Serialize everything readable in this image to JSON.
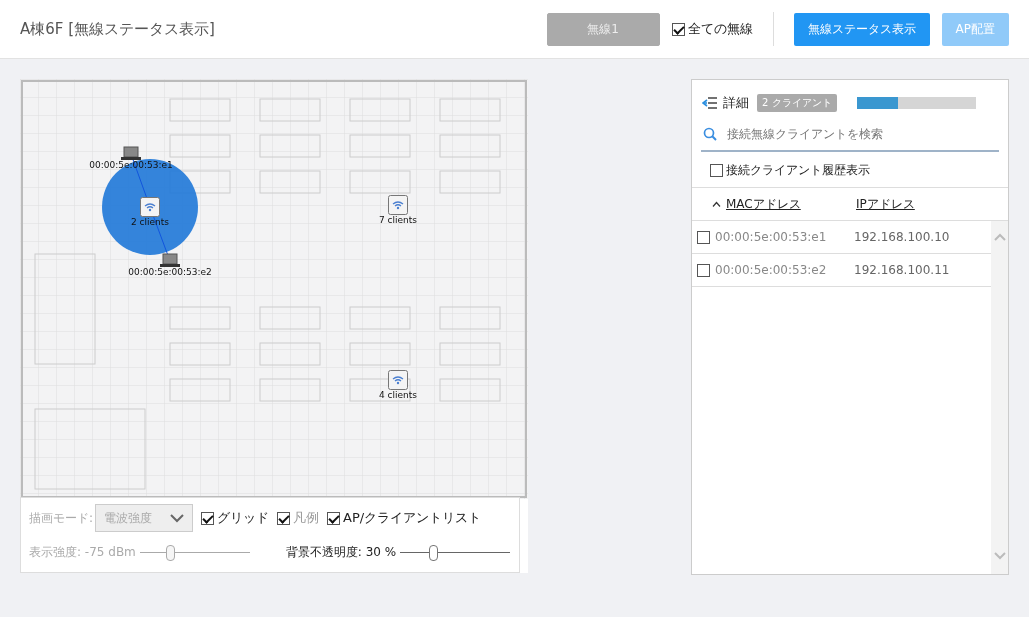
{
  "header": {
    "title": "A棟6F [無線ステータス表示]",
    "radio_select": {
      "label": "無線1",
      "disabled": true
    },
    "all_radios": {
      "label": "全ての無線",
      "checked": true
    },
    "buttons": [
      {
        "label": "無線ステータス表示",
        "disabled": false
      },
      {
        "label": "AP配置",
        "disabled": true
      }
    ]
  },
  "map": {
    "access_points": [
      {
        "label": "2 clients",
        "selected": true,
        "clients": [
          {
            "label": "00:00:5e:00:53:e1"
          },
          {
            "label": "00:00:5e:00:53:e2"
          }
        ]
      },
      {
        "label": "7 clients",
        "selected": false
      },
      {
        "label": "4 clients",
        "selected": false
      }
    ],
    "controls": {
      "mode_label": "描画モード:",
      "mode_select": {
        "value": "電波強度",
        "disabled": true
      },
      "checkboxes": [
        {
          "label": "グリッド",
          "checked": true,
          "disabled": false
        },
        {
          "label": "凡例",
          "checked": true,
          "disabled": true
        },
        {
          "label": "AP/クライアントリスト",
          "checked": true,
          "disabled": false
        }
      ],
      "sliders": [
        {
          "label": "表示強度: -75 dBm",
          "level": 0.27,
          "disabled": true
        },
        {
          "label": "背景不透明度: 30 %",
          "level": 0.3,
          "disabled": false
        }
      ]
    }
  },
  "details": {
    "title": "詳細",
    "badge": "2 クライアント",
    "level": 0.35,
    "search": {
      "placeholder": "接続無線クライアントを検索"
    },
    "history": {
      "label": "接続クライアント履歴表示",
      "checked": false
    },
    "columns": [
      {
        "label": "MACアドレス",
        "sorted": true
      },
      {
        "label": "IPアドレス",
        "sorted": false
      }
    ],
    "rows": [
      {
        "mac": "00:00:5e:00:53:e1",
        "ip": "192.168.100.10",
        "checked": false
      },
      {
        "mac": "00:00:5e:00:53:e2",
        "ip": "192.168.100.11",
        "checked": false
      }
    ]
  }
}
